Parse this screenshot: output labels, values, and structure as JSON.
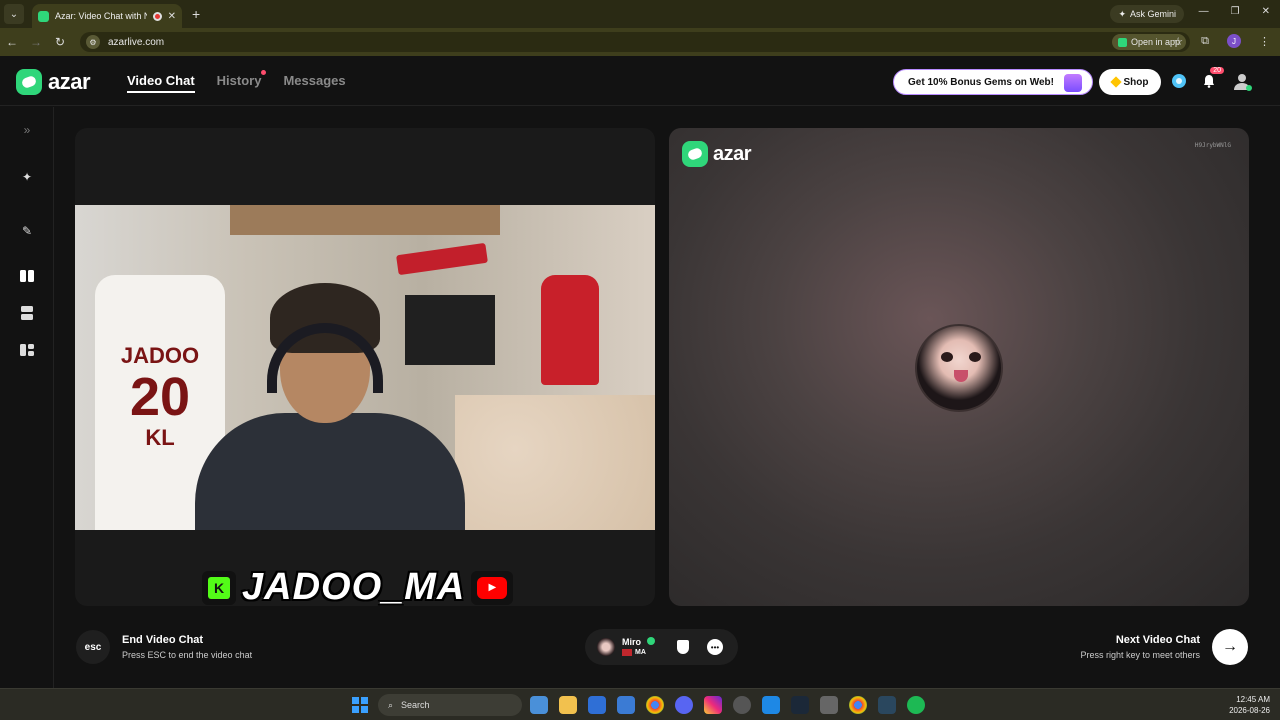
{
  "browser": {
    "tab_title": "Azar: Video Chat with New",
    "new_tab": "+",
    "ask_gemini": "Ask Gemini",
    "url": "azarlive.com",
    "open_in_app": "Open in app",
    "profile_initial": "J"
  },
  "app": {
    "logo_text": "azar",
    "nav": {
      "video_chat": "Video Chat",
      "history": "History",
      "messages": "Messages"
    },
    "promo": "Get 10% Bonus Gems on Web!",
    "shop": "Shop",
    "notification_count": "20"
  },
  "stream": {
    "streamer_name": "JADOO_MA",
    "jersey_name": "JADOO",
    "jersey_number": "20",
    "jersey_initials": "KL",
    "kick_letter": "K"
  },
  "peer_panel": {
    "logo_text": "azar",
    "session_id": "H9JrybWNlG"
  },
  "controls": {
    "esc_label": "esc",
    "end_title": "End Video Chat",
    "end_sub": "Press ESC to end the video chat",
    "peer_name": "Miro",
    "peer_country": "MA",
    "next_title": "Next Video Chat",
    "next_sub": "Press right key to meet others",
    "next_arrow": "→"
  },
  "taskbar": {
    "search_placeholder": "Search",
    "time": "12:45 AM",
    "date": "2026-08-26"
  }
}
